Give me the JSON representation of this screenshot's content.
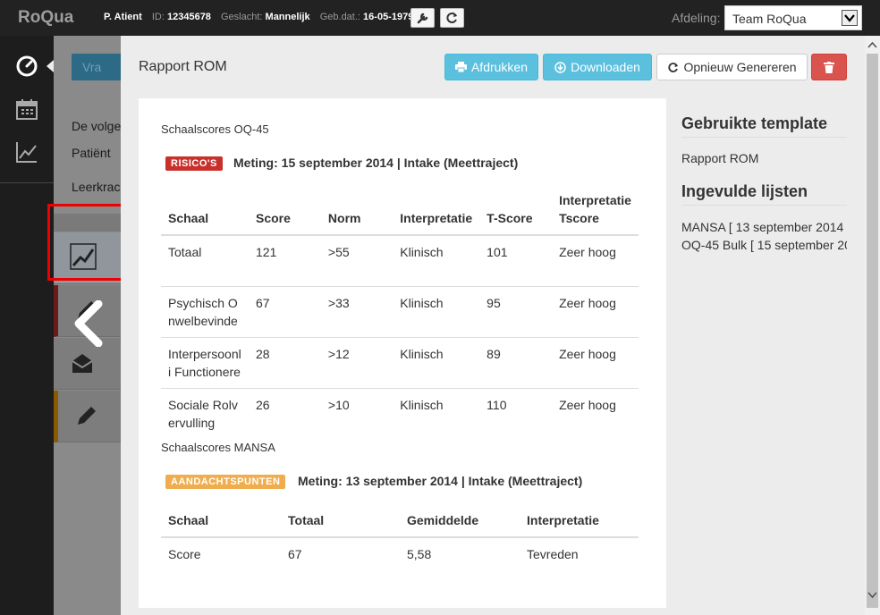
{
  "topbar": {
    "brand": "RoQua",
    "patient_name": "P. Atient",
    "id_label": "ID:",
    "id_value": "12345678",
    "gender_label": "Geslacht:",
    "gender_value": "Mannelijk",
    "dob_label": "Geb.dat.:",
    "dob_value": "16-05-1979",
    "department_label": "Afdeling:",
    "department_value": "Team RoQua"
  },
  "background": {
    "button_label": "Vra",
    "line1": "De volge",
    "line2": "Patiënt",
    "line3": "Leerkrac"
  },
  "modal": {
    "title": "Rapport ROM",
    "print_label": "Afdrukken",
    "download_label": "Downloaden",
    "regenerate_label": "Opnieuw Genereren",
    "section1": {
      "title": "Schaalscores OQ-45",
      "badge": "RISICO'S",
      "meting": "Meting: 15 september 2014 | Intake (Meettraject)",
      "headers": [
        "Schaal",
        "Score",
        "Norm",
        "Interpretatie",
        "T-Score",
        "Interpretatie Tscore"
      ],
      "rows": [
        [
          "Totaal",
          "121",
          ">55",
          "Klinisch",
          "101",
          "Zeer hoog"
        ],
        [
          "Psychisch Onwelbevinde",
          "67",
          ">33",
          "Klinisch",
          "95",
          "Zeer hoog"
        ],
        [
          "Interpersoonli Functioneren",
          "28",
          ">12",
          "Klinisch",
          "89",
          "Zeer hoog"
        ],
        [
          "Sociale Rolvervulling",
          "26",
          ">10",
          "Klinisch",
          "110",
          "Zeer hoog"
        ]
      ]
    },
    "section2": {
      "title": "Schaalscores MANSA",
      "badge": "AANDACHTSPUNTEN",
      "meting": "Meting: 13 september 2014 | Intake (Meettraject)",
      "headers": [
        "Schaal",
        "Totaal",
        "Gemiddelde",
        "Interpretatie"
      ],
      "rows": [
        [
          "Score",
          "67",
          "5,58",
          "Tevreden"
        ]
      ]
    },
    "sidebar": {
      "template_heading": "Gebruikte template",
      "template_value": "Rapport ROM",
      "lists_heading": "Ingevulde lijsten",
      "lists": [
        "MANSA [ 13 september 2014",
        "OQ-45 Bulk [ 15 september 20"
      ]
    }
  },
  "colors": {
    "info": "#5bc0de",
    "danger": "#d9534f",
    "warning": "#f0ad4e",
    "highlight": "#e00000"
  }
}
